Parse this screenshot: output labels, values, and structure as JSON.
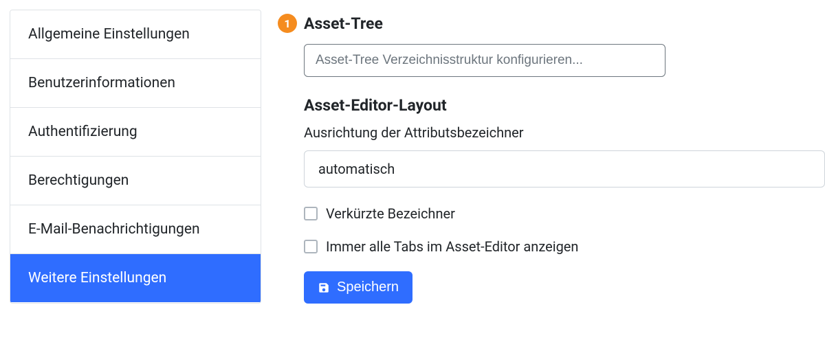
{
  "sidebar": {
    "items": [
      {
        "label": "Allgemeine Einstellungen"
      },
      {
        "label": "Benutzerinformationen"
      },
      {
        "label": "Authentifizierung"
      },
      {
        "label": "Berechtigungen"
      },
      {
        "label": "E-Mail-Benachrichtigungen"
      },
      {
        "label": "Weitere Einstellungen"
      }
    ],
    "activeIndex": 5
  },
  "main": {
    "badge_number": "1",
    "heading_asset_tree": "Asset-Tree",
    "config_button_label": "Asset-Tree Verzeichnisstruktur konfigurieren...",
    "heading_editor_layout": "Asset-Editor-Layout",
    "alignment_label": "Ausrichtung der Attributsbezeichner",
    "alignment_value": "automatisch",
    "checkbox_short_label": "Verkürzte Bezeichner",
    "checkbox_tabs_label": "Immer alle Tabs im Asset-Editor anzeigen",
    "save_label": "Speichern"
  }
}
